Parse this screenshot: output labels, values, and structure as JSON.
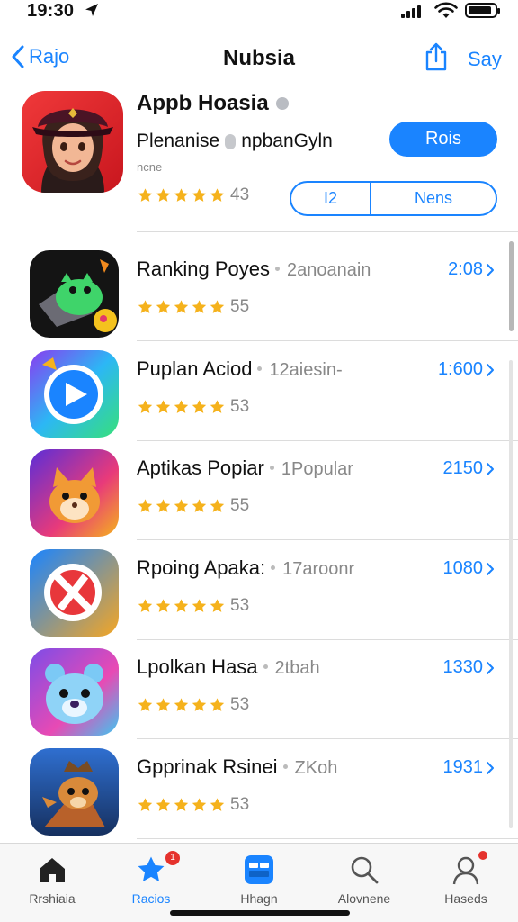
{
  "status_bar": {
    "time": "19:30"
  },
  "nav": {
    "back_label": "Rajo",
    "title": "Nubsia",
    "action_label": "Say"
  },
  "header": {
    "name": "Appb Hoasia",
    "subtitle_left": "Plenanise",
    "subtitle_right": "npbanGyln",
    "meta": "ncne",
    "rating_count": "43",
    "get_label": "Rois",
    "segment_left": "I2",
    "segment_right": "Nens"
  },
  "apps": [
    {
      "name": "Ranking Poyes",
      "sub": "2anoanain",
      "count": "55",
      "value": "2:08",
      "icon": "game-creature-icon"
    },
    {
      "name": "Puplan Aciod",
      "sub": "12aiesin-",
      "count": "53",
      "value": "1:600",
      "icon": "play-button-icon"
    },
    {
      "name": "Aptikas Popiar",
      "sub": "1Popular",
      "count": "55",
      "value": "2150",
      "icon": "fox-character-icon"
    },
    {
      "name": "Rpoing Apaka:",
      "sub": "17aroonr",
      "count": "53",
      "value": "1080",
      "icon": "no-sign-icon"
    },
    {
      "name": "Lpolkan Hasa",
      "sub": "2tbah",
      "count": "53",
      "value": "1330",
      "icon": "bear-character-icon"
    },
    {
      "name": "Gpprinak Rsinei",
      "sub": "ZKoh",
      "count": "53",
      "value": "1931",
      "icon": "dog-character-icon"
    }
  ],
  "tabs": [
    {
      "label": "Rrshiaia",
      "icon": "home-icon",
      "active": false
    },
    {
      "label": "Racios",
      "icon": "star-icon",
      "active": true,
      "badge": "1"
    },
    {
      "label": "Hhagn",
      "icon": "apps-icon",
      "active": false
    },
    {
      "label": "Alovnene",
      "icon": "search-icon",
      "active": false
    },
    {
      "label": "Haseds",
      "icon": "profile-icon",
      "active": false,
      "badge": ""
    }
  ],
  "colors": {
    "accent": "#1a84ff",
    "star": "#f5b21c",
    "badge": "#e5322d"
  }
}
